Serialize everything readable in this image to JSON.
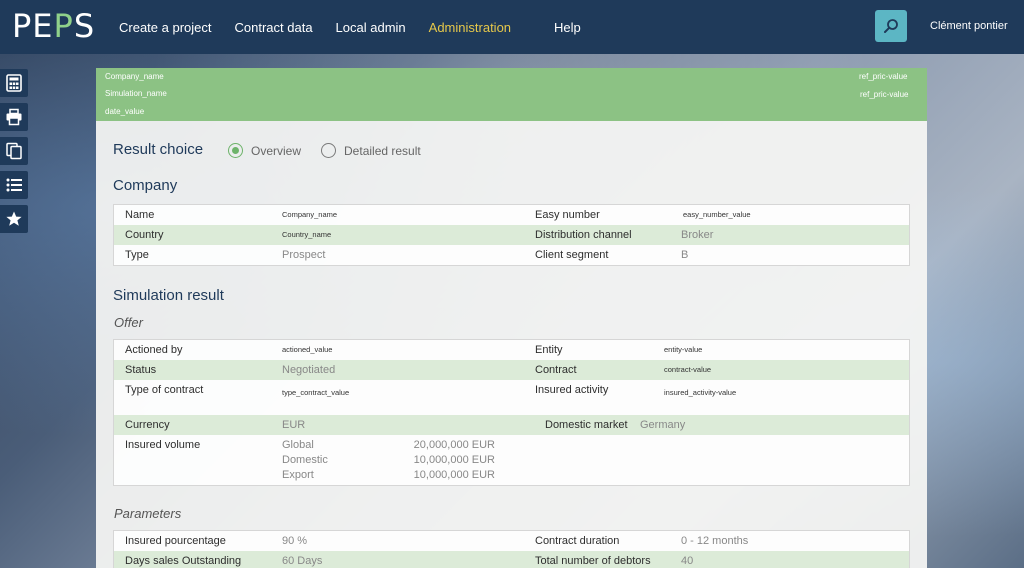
{
  "app": {
    "logo_part1": "PE",
    "logo_part2": "P",
    "logo_part3": "S",
    "accent_color": "#8cc284",
    "nav_color": "#1f3a5a",
    "active_color": "#e6c84a"
  },
  "nav": {
    "create_project": "Create a project",
    "contract_data": "Contract data",
    "local_admin": "Local admin",
    "administration": "Administration",
    "help": "Help"
  },
  "user": {
    "name": "Clément pontier"
  },
  "toolbar_icons": [
    "calculator-icon",
    "printer-icon",
    "copy-icon",
    "list-icon",
    "star-icon"
  ],
  "header_band": {
    "company_name": "Company_name",
    "simulation_name": "Simulation_name",
    "date_value": "date_value",
    "ref_pric_1": "ref_pric-value",
    "ref_pric_2": "ref_pric-value"
  },
  "result_choice": {
    "title": "Result choice",
    "overview": "Overview",
    "detailed": "Detailed result",
    "selected": "Overview"
  },
  "company": {
    "title": "Company",
    "name_label": "Name",
    "name_value": "Company_name",
    "easy_label": "Easy number",
    "easy_value": "easy_number_value",
    "country_label": "Country",
    "country_value": "Country_name",
    "channel_label": "Distribution channel",
    "channel_value": "Broker",
    "type_label": "Type",
    "type_value": "Prospect",
    "segment_label": "Client segment",
    "segment_value": "B"
  },
  "simulation": {
    "title": "Simulation result",
    "offer_title": "Offer",
    "actioned_label": "Actioned by",
    "actioned_value": "actioned_value",
    "entity_label": "Entity",
    "entity_value": "entity-value",
    "status_label": "Status",
    "status_value": "Negotiated",
    "contract_label": "Contract",
    "contract_value": "contract-value",
    "type_contract_label": "Type of contract",
    "type_contract_value": "type_contract_value",
    "insured_activity_label": "Insured activity",
    "insured_activity_value": "insured_activity-value",
    "currency_label": "Currency",
    "currency_value": "EUR",
    "domestic_market_label": "Domestic market",
    "domestic_market_value": "Germany",
    "insured_volume_label": "Insured volume",
    "volumes": [
      {
        "label": "Global",
        "value": "20,000,000 EUR"
      },
      {
        "label": "Domestic",
        "value": "10,000,000 EUR"
      },
      {
        "label": "Export",
        "value": "10,000,000 EUR"
      }
    ]
  },
  "parameters": {
    "title": "Parameters",
    "insured_pct_label": "Insured pourcentage",
    "insured_pct_value": "90 %",
    "duration_label": "Contract duration",
    "duration_value": "0 - 12 months",
    "dso_label": "Days sales Outstanding",
    "dso_value": "60 Days",
    "debtors_label": "Total number of debtors",
    "debtors_value": "40"
  }
}
